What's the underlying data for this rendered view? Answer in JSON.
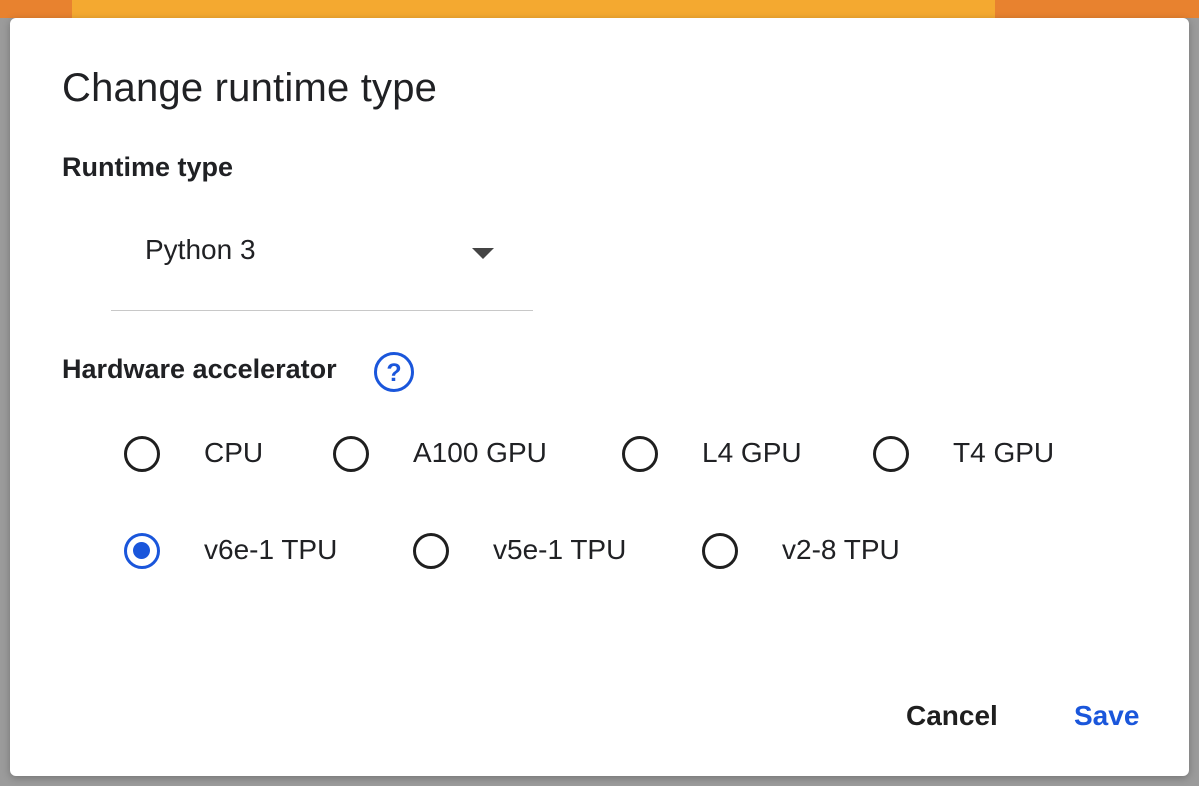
{
  "dialog": {
    "title": "Change runtime type",
    "runtime_type": {
      "label": "Runtime type",
      "selected": "Python 3"
    },
    "hardware_accelerator": {
      "label": "Hardware accelerator",
      "help_icon": "help-circle-icon",
      "options": [
        {
          "label": "CPU",
          "checked": false
        },
        {
          "label": "A100 GPU",
          "checked": false
        },
        {
          "label": "L4 GPU",
          "checked": false
        },
        {
          "label": "T4 GPU",
          "checked": false
        },
        {
          "label": "v6e-1 TPU",
          "checked": true
        },
        {
          "label": "v5e-1 TPU",
          "checked": false
        },
        {
          "label": "v2-8 TPU",
          "checked": false
        }
      ]
    },
    "buttons": {
      "cancel": "Cancel",
      "save": "Save"
    }
  },
  "colors": {
    "accent": "#1a56db",
    "top_strip_orange": "#e8822f",
    "top_strip_yellow": "#f4a930",
    "text": "#202124"
  }
}
